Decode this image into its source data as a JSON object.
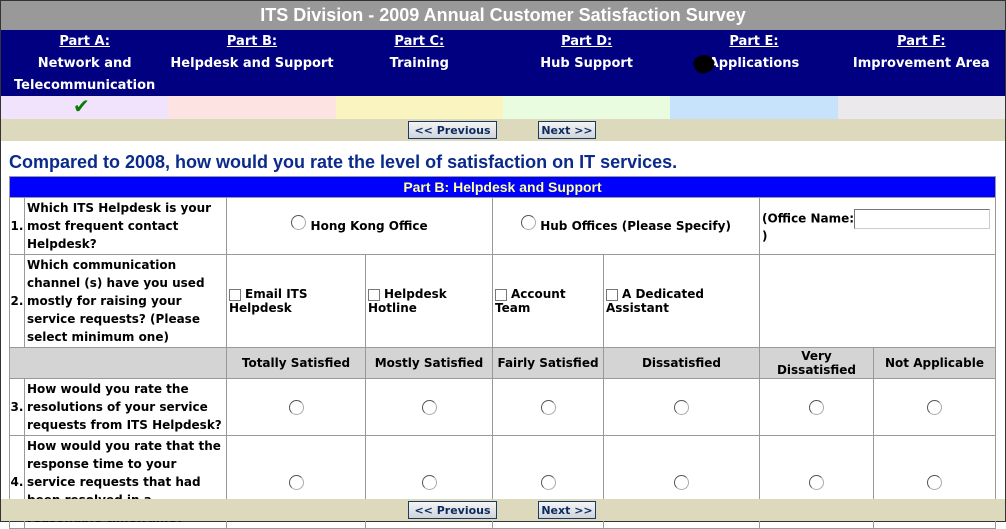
{
  "title": "ITS Division - 2009 Annual Customer Satisfaction Survey",
  "nav": [
    {
      "part": "Part A:",
      "name": "Network and Telecommunication",
      "status_color": "#f1e3fb",
      "completed": true
    },
    {
      "part": "Part B:",
      "name": "Helpdesk and Support",
      "status_color": "#fde3e1",
      "completed": false
    },
    {
      "part": "Part C:",
      "name": "Training",
      "status_color": "#faf5c0",
      "completed": false
    },
    {
      "part": "Part D:",
      "name": "Hub Support",
      "status_color": "#e9fce0",
      "completed": false
    },
    {
      "part": "Part E:",
      "name": "Applications",
      "status_color": "#c6e3fb",
      "completed": false
    },
    {
      "part": "Part F:",
      "name": "Improvement Area",
      "status_color": "#ece9ec",
      "completed": false
    }
  ],
  "check_icon": "✔",
  "buttons": {
    "previous": "<< Previous",
    "next": "Next >>"
  },
  "question_heading": "Compared to 2008, how would you rate the level of satisfaction on IT services.",
  "section_title": "Part B: Helpdesk and Support",
  "q1": {
    "num": "1.",
    "text": "Which ITS Helpdesk is your most frequent contact Helpdesk?",
    "options": [
      "Hong Kong Office",
      "Hub Offices (Please Specify)"
    ],
    "office_label_open": "(Office Name:",
    "office_label_close": ")",
    "office_value": ""
  },
  "q2": {
    "num": "2.",
    "text": "Which communication channel (s) have you used mostly for raising your service requests? (Please select minimum one)",
    "options": [
      "Email ITS Helpdesk",
      "Helpdesk Hotline",
      "Account Team",
      "A Dedicated Assistant"
    ]
  },
  "rating_headers": [
    "Totally Satisfied",
    "Mostly Satisfied",
    "Fairly Satisfied",
    "Dissatisfied",
    "Very Dissatisfied",
    "Not Applicable"
  ],
  "q3": {
    "num": "3.",
    "text": "How would you rate the resolutions of your service requests from ITS Helpdesk?"
  },
  "q4": {
    "num": "4.",
    "text": "How would you rate that the response time to your service requests that had been resolved in a reasonable timeframe?"
  }
}
